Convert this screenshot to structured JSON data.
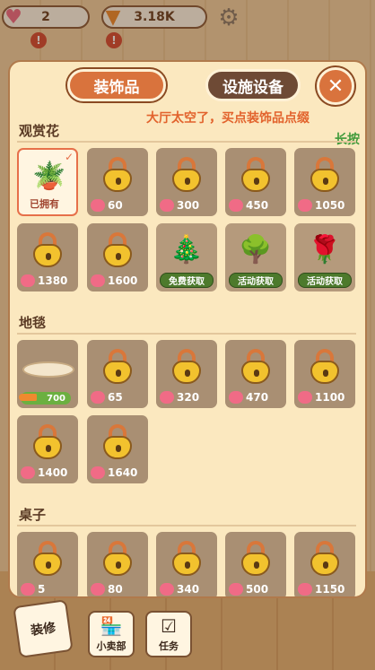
{
  "hud": {
    "hearts": "2",
    "carrots": "3.18K"
  },
  "tabs": {
    "decor": "装饰品",
    "facility": "设施设备"
  },
  "notice": {
    "line1": "大厅太空了，买点装饰品点缀",
    "line2": "长按"
  },
  "sections": [
    {
      "title": "观赏花",
      "items": [
        {
          "state": "owned",
          "label": "已拥有"
        },
        {
          "state": "locked",
          "price": "60"
        },
        {
          "state": "locked",
          "price": "300"
        },
        {
          "state": "locked",
          "price": "450"
        },
        {
          "state": "locked",
          "price": "1050"
        },
        {
          "state": "locked",
          "price": "1380"
        },
        {
          "state": "locked",
          "price": "1600"
        },
        {
          "state": "event",
          "label": "免费获取"
        },
        {
          "state": "event",
          "label": "活动获取"
        },
        {
          "state": "event",
          "label": "活动获取"
        }
      ]
    },
    {
      "title": "地毯",
      "items": [
        {
          "state": "carrot",
          "price": "700"
        },
        {
          "state": "locked",
          "price": "65"
        },
        {
          "state": "locked",
          "price": "320"
        },
        {
          "state": "locked",
          "price": "470"
        },
        {
          "state": "locked",
          "price": "1100"
        },
        {
          "state": "locked",
          "price": "1400"
        },
        {
          "state": "locked",
          "price": "1640"
        }
      ]
    },
    {
      "title": "桌子",
      "items": [
        {
          "state": "locked",
          "price": "5"
        },
        {
          "state": "locked",
          "price": "80"
        },
        {
          "state": "locked",
          "price": "340"
        },
        {
          "state": "locked",
          "price": "500"
        },
        {
          "state": "locked",
          "price": "1150"
        }
      ]
    }
  ],
  "bottom": {
    "decorate": "装修",
    "shop": "小卖部",
    "tasks": "任务"
  },
  "colors": {
    "accent": "#d9733d",
    "panel": "#fbe8bf",
    "heart": "#f06b86",
    "lock": "#f2c22e"
  }
}
